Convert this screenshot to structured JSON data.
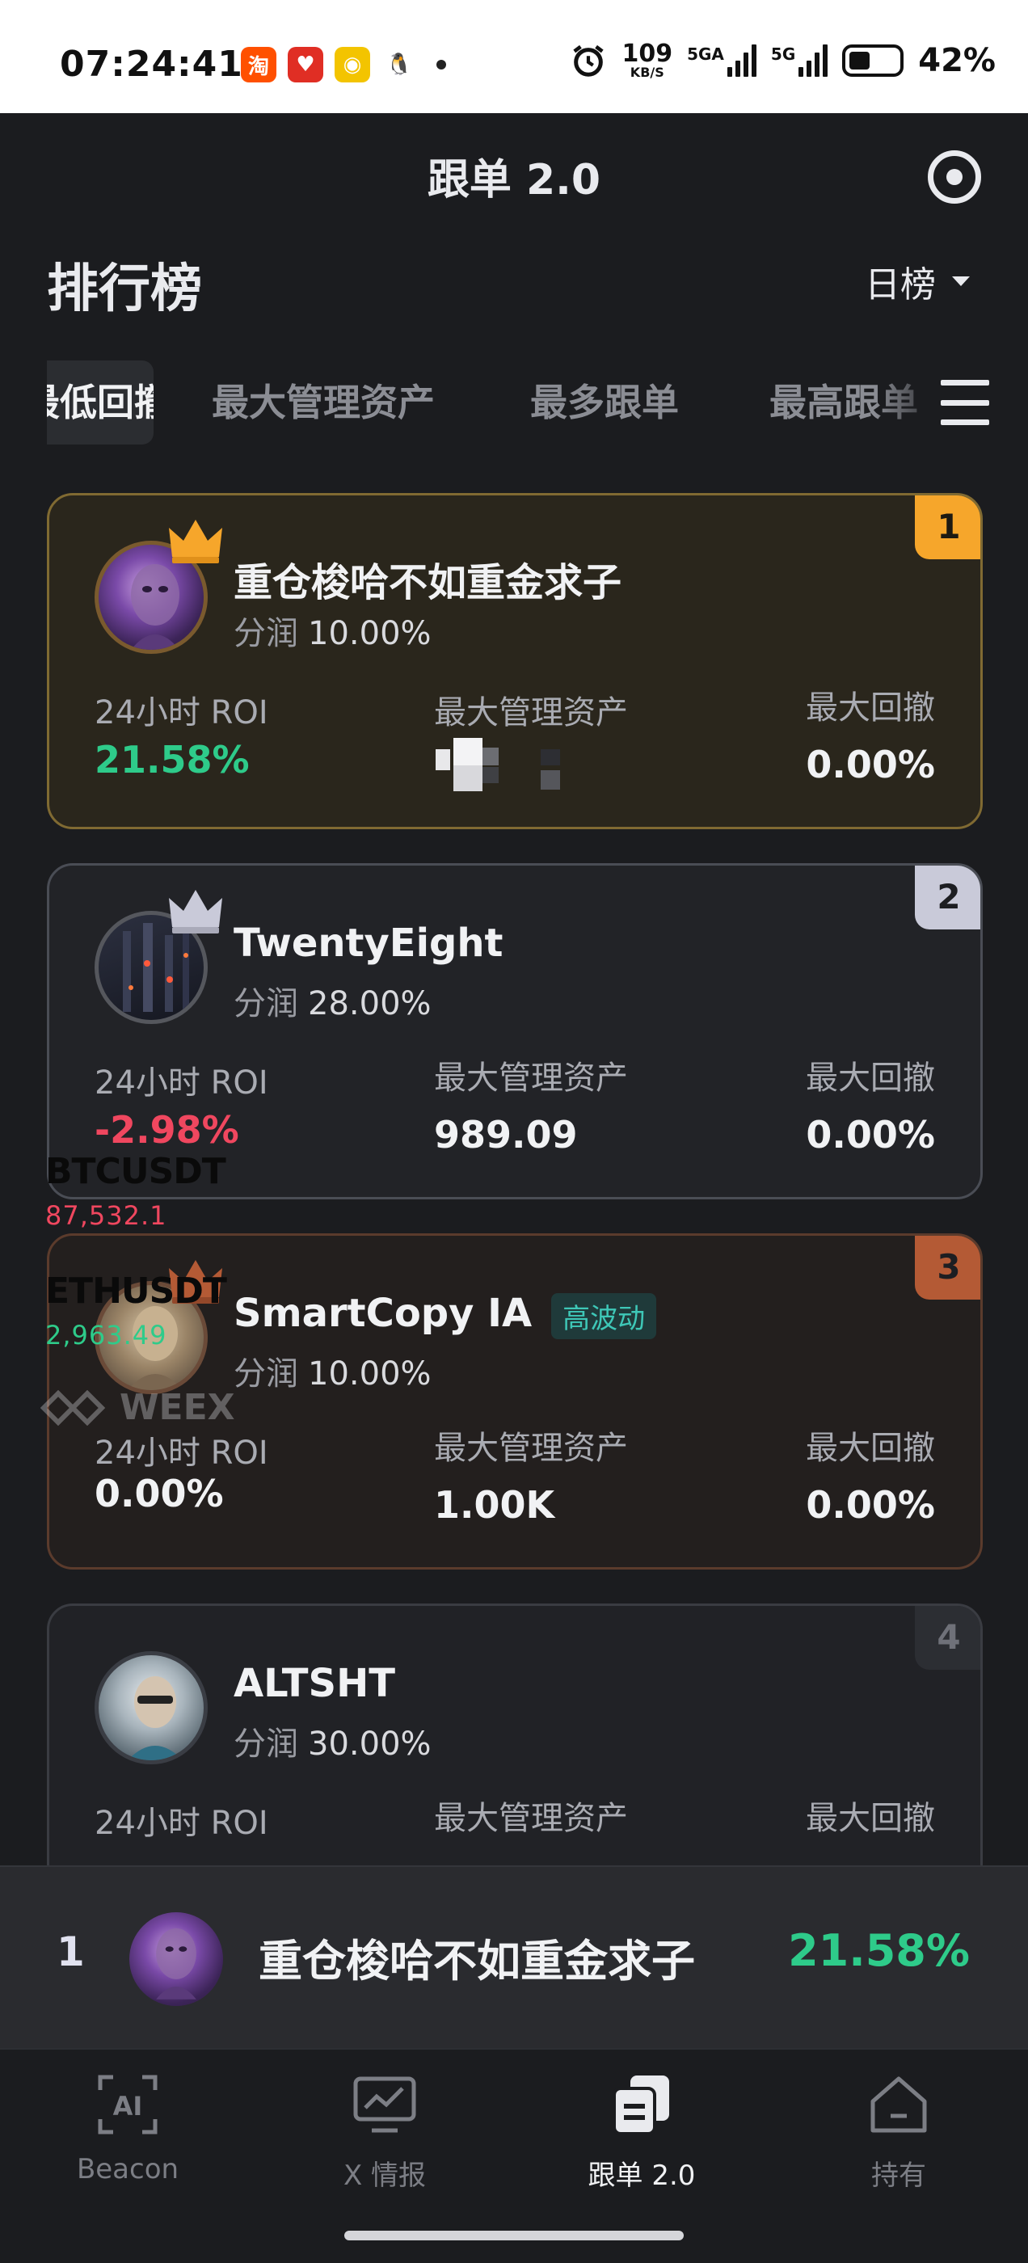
{
  "status_bar": {
    "time": "07:24:41",
    "speed_value": "109",
    "speed_unit": "KB/S",
    "net1": "5GA",
    "net2": "5G",
    "battery_percent": "42%",
    "battery_level": 0.42
  },
  "header": {
    "title": "跟单 2.0",
    "page_title": "排行榜",
    "period": "日榜"
  },
  "tabs": [
    {
      "label": "最低回撤",
      "active": true
    },
    {
      "label": "最大管理资产",
      "active": false
    },
    {
      "label": "最多跟单",
      "active": false
    },
    {
      "label": "最高跟单",
      "active": false
    }
  ],
  "labels": {
    "share": "分润",
    "roi": "24小时 ROI",
    "aum": "最大管理资产",
    "drawdown": "最大回撤"
  },
  "traders": [
    {
      "rank": "1",
      "name": "重仓梭哈不如重金求子",
      "share": "10.00%",
      "roi": "21.58%",
      "roi_sign": "positive",
      "aum": "",
      "drawdown": "0.00%",
      "tag": ""
    },
    {
      "rank": "2",
      "name": "TwentyEight",
      "share": "28.00%",
      "roi": "-2.98%",
      "roi_sign": "negative",
      "aum": "989.09",
      "drawdown": "0.00%",
      "tag": ""
    },
    {
      "rank": "3",
      "name": "SmartCopy IA",
      "share": "10.00%",
      "roi": "0.00%",
      "roi_sign": "neutral",
      "aum": "1.00K",
      "drawdown": "0.00%",
      "tag": "高波动"
    },
    {
      "rank": "4",
      "name": "ALTSHT",
      "share": "30.00%",
      "roi": "",
      "roi_sign": "positive",
      "aum": "",
      "drawdown": "",
      "tag": ""
    }
  ],
  "ticker": [
    {
      "symbol": "BTCUSDT",
      "price": "87,532.1",
      "color": "#f0475f"
    },
    {
      "symbol": "ETHUSDT",
      "price": "2,963.49",
      "color": "#2ecb8a"
    }
  ],
  "watermark": "WEEX",
  "pinned": {
    "rank": "1",
    "name": "重仓梭哈不如重金求子",
    "roi": "21.58%"
  },
  "nav": [
    {
      "label": "Beacon",
      "icon": "ai-icon",
      "active": false
    },
    {
      "label": "X 情报",
      "icon": "monitor-chart-icon",
      "active": false
    },
    {
      "label": "跟单 2.0",
      "icon": "copy-docs-icon",
      "active": true
    },
    {
      "label": "持有",
      "icon": "home-icon",
      "active": false
    }
  ],
  "colors": {
    "accent_green": "#2ecb8a",
    "accent_red": "#f0475f",
    "gold": "#f6a62b",
    "bg": "#1b1c1f"
  }
}
